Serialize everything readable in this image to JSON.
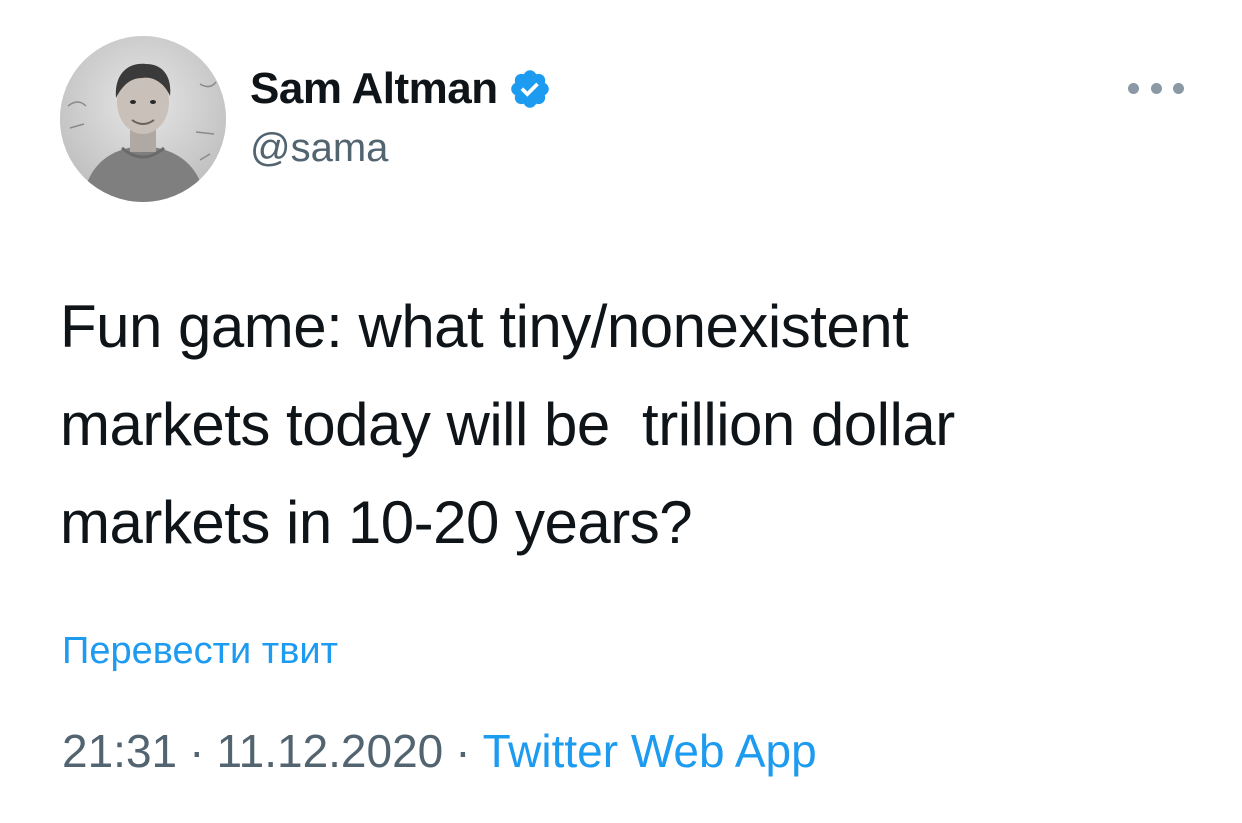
{
  "author": {
    "display_name": "Sam Altman",
    "handle": "@sama",
    "verified": true,
    "verified_icon": "verified-badge-icon",
    "verified_color": "#1d9bf0"
  },
  "tweet": {
    "text": "Fun game: what tiny/nonexistent\nmarkets today will be  trillion dollar\nmarkets in 10-20 years?",
    "translate_label": "Перевести твит",
    "time": "21:31",
    "separator": "·",
    "date": "11.12.2020",
    "source": "Twitter Web App"
  },
  "menu": {
    "icon": "more-horizontal-icon"
  },
  "colors": {
    "text": "#0f1419",
    "secondary": "#536471",
    "link": "#1d9bf0"
  }
}
